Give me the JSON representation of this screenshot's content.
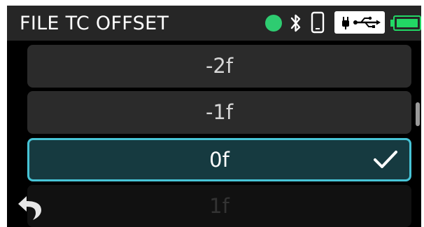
{
  "header": {
    "title": "FILE TC OFFSET",
    "icons": [
      "status-dot",
      "bluetooth-icon",
      "phone-icon",
      "usb-power-icon",
      "battery-icon"
    ]
  },
  "options": [
    {
      "label": "-2f",
      "selected": false
    },
    {
      "label": "-1f",
      "selected": false
    },
    {
      "label": "0f",
      "selected": true
    },
    {
      "label": "1f",
      "selected": false
    }
  ],
  "colors": {
    "accent": "#47c4d6",
    "selected_bg": "#163a40",
    "status_green": "#2ecc71",
    "battery_green": "#22d865"
  }
}
